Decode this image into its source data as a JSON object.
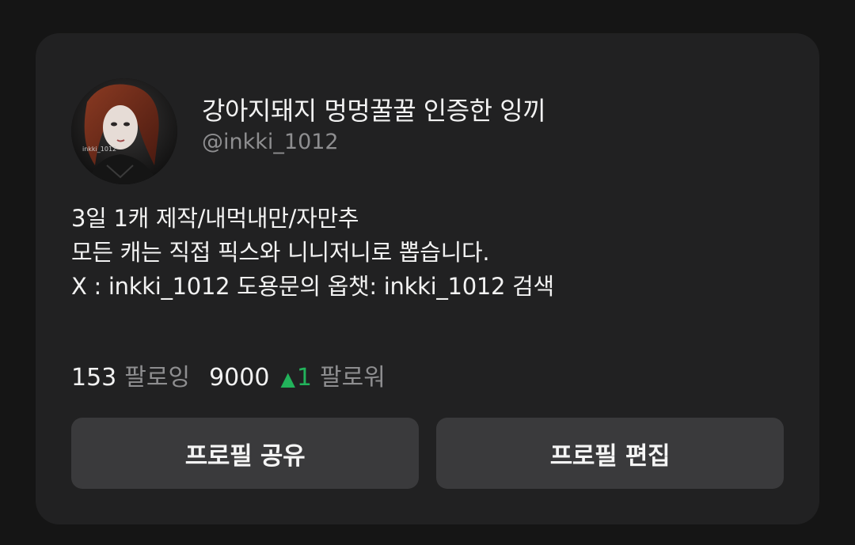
{
  "profile": {
    "display_name": "강아지돼지 멍멍꿀꿀 인증한 잉끼",
    "handle": "@inkki_1012",
    "avatar_watermark": "inkki_1012"
  },
  "bio": {
    "lines": [
      "3일 1캐 제작/내먹내만/자만추",
      "모든 캐는 직접 픽스와 니니저니로 뽑습니다.",
      "X :  inkki_1012 도용문의 옵챗: inkki_1012 검색"
    ]
  },
  "stats": {
    "following_count": "153",
    "following_label": "팔로잉",
    "followers_count": "9000",
    "followers_delta_arrow": "▲",
    "followers_delta": "1",
    "followers_label": "팔로워",
    "delta_color": "#22b35b"
  },
  "actions": {
    "share_label": "프로필 공유",
    "edit_label": "프로필 편집"
  }
}
